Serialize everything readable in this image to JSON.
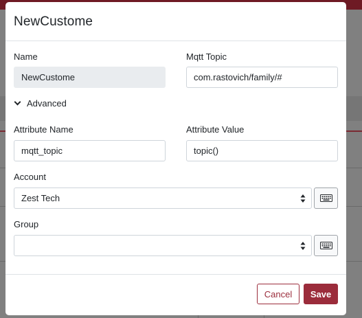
{
  "modal": {
    "title": "NewCustome"
  },
  "form": {
    "name_label": "Name",
    "name_value": "NewCustome",
    "mqtt_label": "Mqtt Topic",
    "mqtt_value": "com.rastovich/family/#",
    "advanced_label": "Advanced",
    "attr_name_label": "Attribute Name",
    "attr_name_value": "mqtt_topic",
    "attr_value_label": "Attribute Value",
    "attr_value_value": "topic()",
    "account_label": "Account",
    "account_value": "Zest Tech",
    "group_label": "Group",
    "group_value": ""
  },
  "footer": {
    "cancel_label": "Cancel",
    "save_label": "Save"
  },
  "colors": {
    "accent": "#9b2c3b"
  },
  "icons": [
    "chevron-down-icon",
    "select-arrows-icon",
    "keyboard-icon"
  ]
}
